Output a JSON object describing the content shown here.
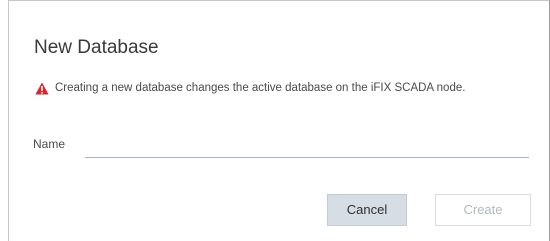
{
  "dialog": {
    "title": "New Database",
    "warning": {
      "icon": "warning-triangle-icon",
      "icon_color": "#d9262e",
      "text": "Creating a new database changes the active database on the iFIX SCADA node."
    },
    "name_field": {
      "label": "Name",
      "value": ""
    },
    "buttons": {
      "cancel_label": "Cancel",
      "create_label": "Create",
      "create_disabled": true
    }
  }
}
